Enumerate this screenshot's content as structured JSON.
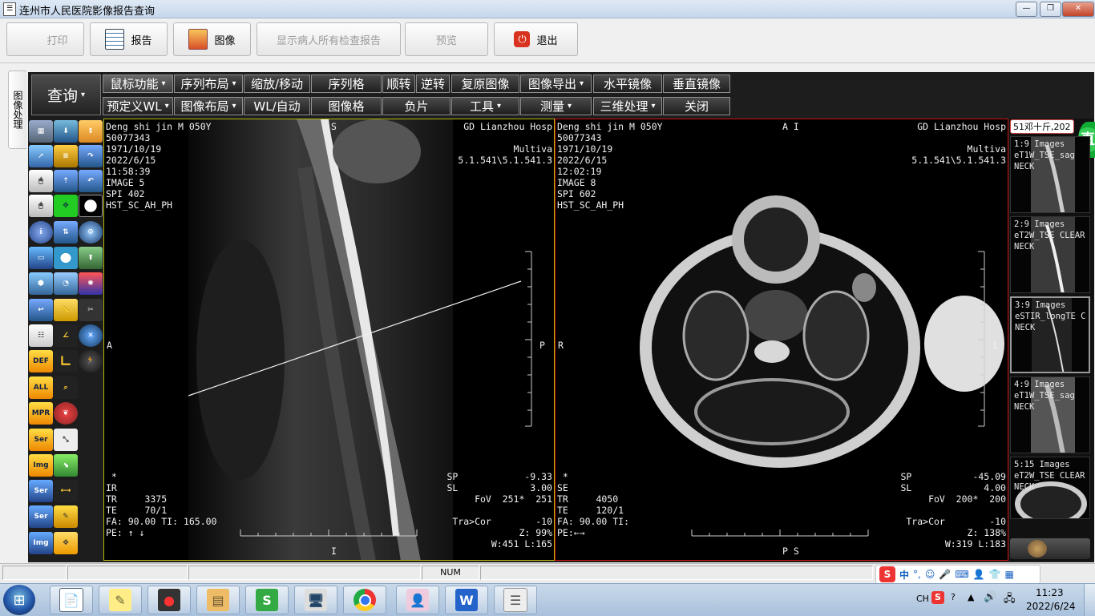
{
  "window": {
    "title": "连州市人民医院影像报告查询",
    "min": "—",
    "max": "❐",
    "close": "✕"
  },
  "toolbar": {
    "print": "打印",
    "report": "报告",
    "image": "图像",
    "show_all": "显示病人所有检查报告",
    "preview": "预览",
    "exit": "退出"
  },
  "side_tab": "图像处理",
  "viewer": {
    "query": "查询",
    "row1": [
      "鼠标功能",
      "序列布局",
      "缩放/移动",
      "序列格",
      "顺转",
      "逆转",
      "复原图像",
      "图像导出",
      "水平镜像",
      "垂直镜像"
    ],
    "row2": [
      "预定义WL",
      "图像布局",
      "WL/自动",
      "图像格",
      "负片",
      "工具",
      "测量",
      "三维处理",
      "关闭"
    ],
    "palette_labels": [
      "DEF",
      "ALL",
      "MPR",
      "Ser",
      "Img",
      "Ser",
      "Ser",
      "Img"
    ]
  },
  "vp1": {
    "tl": "Deng shi jin M 050Y\n50077343\n1971/10/19\n2022/6/15\n11:58:39\nIMAGE 5\nSPI 402\nHST_SC_AH_PH",
    "tc": "S",
    "tr": "GD Lianzhou Hosp\n\nMultiva\n5.1.541\\5.1.541.3",
    "left": "A",
    "right": "P",
    "bl": " *\nIR\nTR     3375\nTE     70/1\nFA: 90.00 TI: 165.00\nPE: ↑ ↓",
    "br": "SP            -9.33\nSL             3.00\nFoV  251*  251\n\nTra>Cor        -10\nZ: 99%\nW:451 L:165",
    "bc": "I"
  },
  "vp2": {
    "tl": "Deng shi jin M 050Y\n50077343\n1971/10/19\n2022/6/15\n12:02:19\nIMAGE 8\nSPI 602\nHST_SC_AH_PH",
    "tc": "A I",
    "tr": "GD Lianzhou Hosp\n\nMultiva\n5.1.541\\5.1.541.3",
    "left": "R",
    "right": "L",
    "bl": " *\nSE\nTR     4050\nTE     120/1\nFA: 90.00 TI:\nPE:←→",
    "br": "SP           -45.09\nSL             4.00\nFoV  200*  200\n\nTra>Cor        -10\nZ: 138%\nW:319 L:183",
    "bc": "P S"
  },
  "thumb_header": "51邓十斤,202",
  "thumbs": [
    "1:9 Images\neT1W_TSE_sag\nNECK",
    "2:9 Images\neT2W_TSE CLEAR\nNECK",
    "3:9 Images\neSTIR_longTE C\nNECK",
    "4:9 Images\neT1W_TSE_sag\nNECK",
    "5:15 Images\neT2W_TSE CLEAR\nNECK"
  ],
  "status": {
    "num": "NUM"
  },
  "ime": {
    "lang": "中",
    "punct": "°,"
  },
  "tray": {
    "lang": "CH",
    "time": "11:23",
    "date": "2022/6/24"
  }
}
